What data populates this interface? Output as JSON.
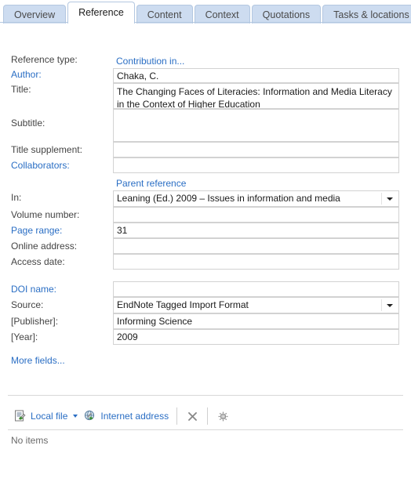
{
  "tabs": [
    {
      "label": "Overview",
      "active": false
    },
    {
      "label": "Reference",
      "active": true
    },
    {
      "label": "Content",
      "active": false
    },
    {
      "label": "Context",
      "active": false
    },
    {
      "label": "Quotations",
      "active": false
    },
    {
      "label": "Tasks & locations",
      "active": false
    }
  ],
  "form": {
    "reference_type": {
      "label": "Reference type:",
      "value": "Contribution in..."
    },
    "author": {
      "label": "Author:",
      "value": "Chaka, C."
    },
    "title": {
      "label": "Title:",
      "value": "The Changing Faces of Literacies: Information and Media Literacy in the Context of Higher Education"
    },
    "subtitle": {
      "label": "Subtitle:",
      "value": ""
    },
    "title_supplement": {
      "label": "Title supplement:",
      "value": ""
    },
    "collaborators": {
      "label": "Collaborators:",
      "value": ""
    },
    "parent_reference_header": "Parent reference",
    "in": {
      "label": "In:",
      "value": "Leaning (Ed.) 2009 – Issues in information and media"
    },
    "volume_number": {
      "label": "Volume number:",
      "value": ""
    },
    "page_range": {
      "label": "Page range:",
      "value": "31"
    },
    "online_address": {
      "label": "Online address:",
      "value": ""
    },
    "access_date": {
      "label": "Access date:",
      "value": ""
    },
    "doi_name": {
      "label": "DOI name:",
      "value": ""
    },
    "source": {
      "label": "Source:",
      "value": "EndNote Tagged Import Format"
    },
    "publisher": {
      "label": "[Publisher]:",
      "value": "Informing Science"
    },
    "year": {
      "label": "[Year]:",
      "value": "2009"
    },
    "more_fields": "More fields..."
  },
  "attachments": {
    "local_file_label": "Local file",
    "internet_address_label": "Internet address",
    "delete_tooltip": "Delete",
    "settings_tooltip": "Settings",
    "empty_text": "No items"
  },
  "colors": {
    "link": "#2a6ec4",
    "tab_inactive": "#cddcf0",
    "tab_border": "#b3c7e0",
    "field_border": "#d2d2d2",
    "label": "#444444"
  }
}
